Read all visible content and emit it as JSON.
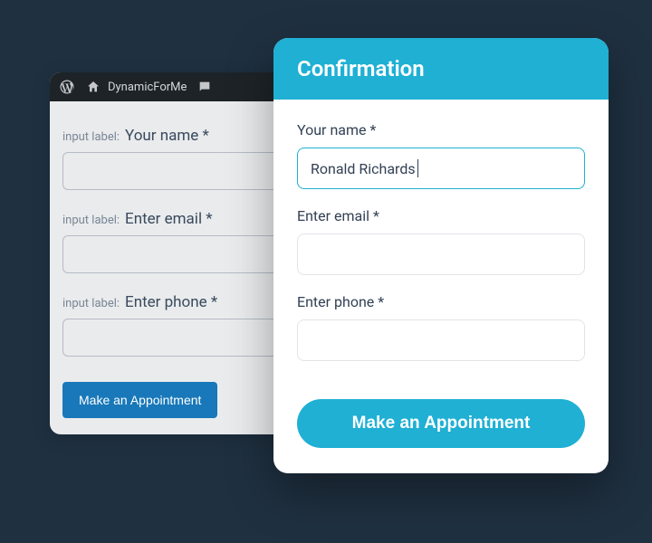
{
  "editor": {
    "adminbar": {
      "site_name": "DynamicForMe"
    },
    "meta_label": "input label:",
    "fields": {
      "name": {
        "label": "Your name *"
      },
      "email": {
        "label": "Enter email *"
      },
      "phone": {
        "label": "Enter phone *"
      }
    },
    "submit_label": "Make an Appointment"
  },
  "modal": {
    "title": "Confirmation",
    "fields": {
      "name": {
        "label": "Your name *",
        "value": "Ronald Richards"
      },
      "email": {
        "label": "Enter email *",
        "value": ""
      },
      "phone": {
        "label": "Enter phone *",
        "value": ""
      }
    },
    "submit_label": "Make an Appointment"
  }
}
